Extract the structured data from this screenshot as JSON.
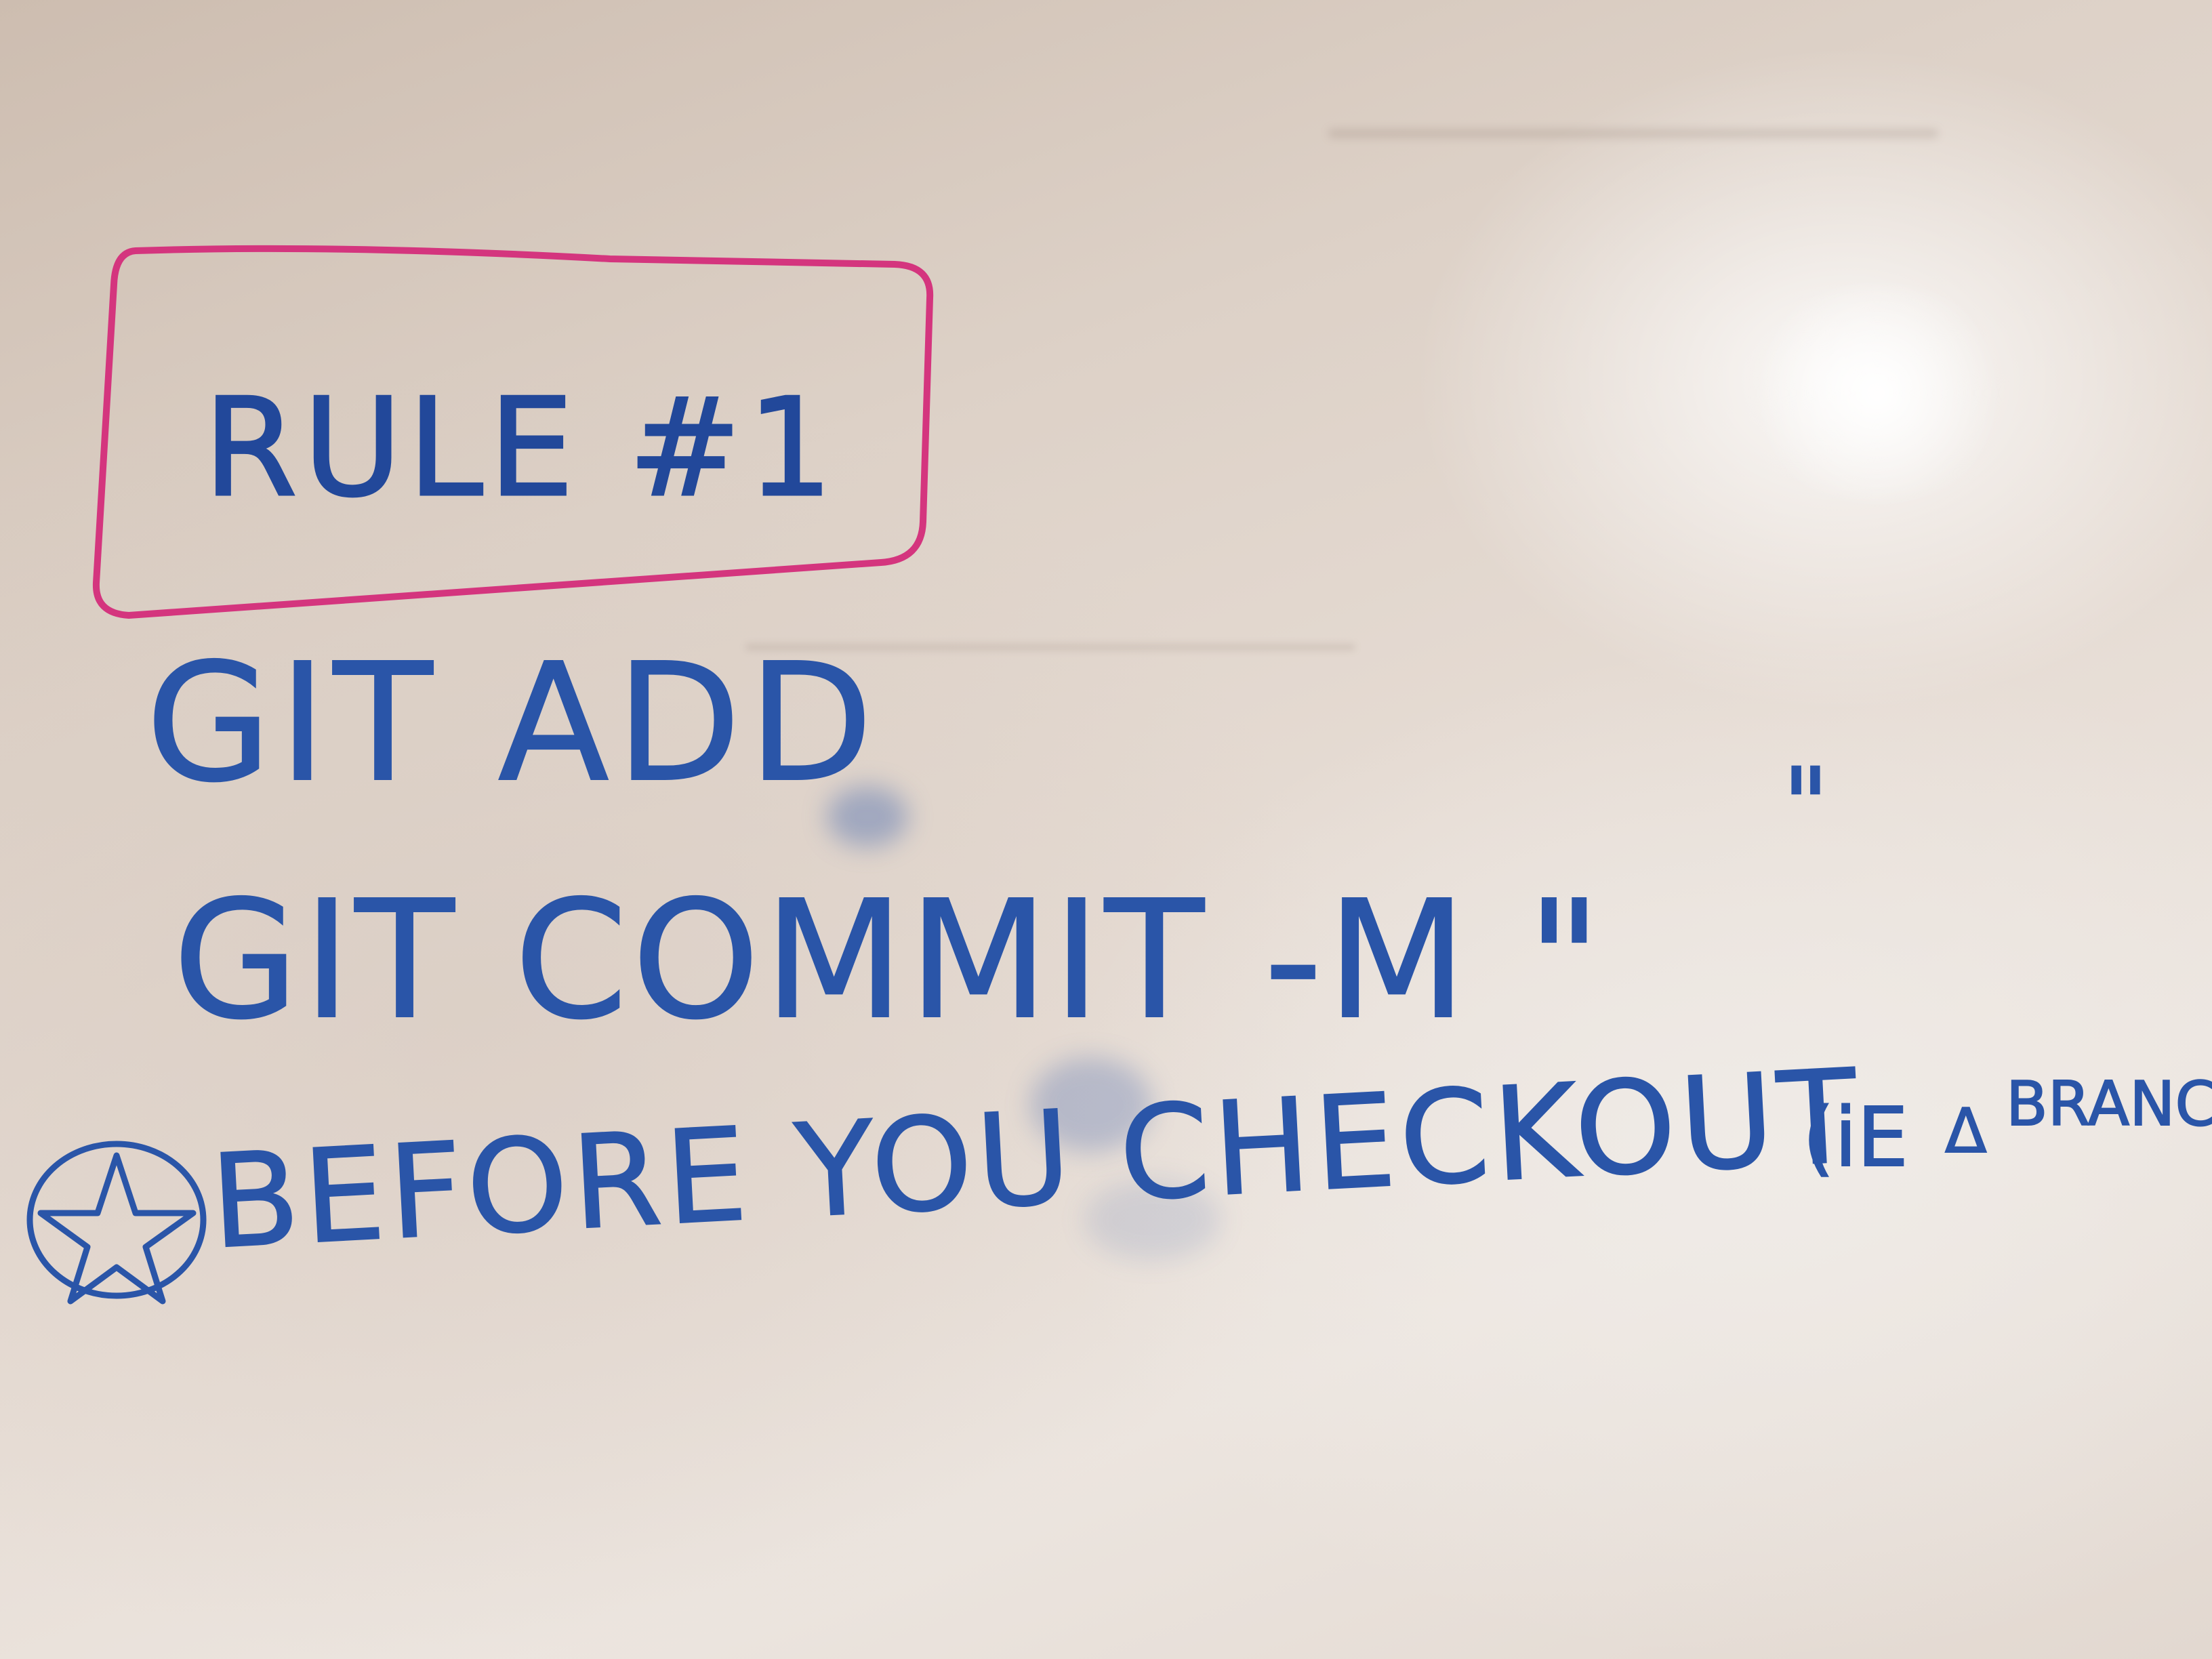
{
  "whiteboard": {
    "rule_title": "RULE #1",
    "lines": [
      "GIT ADD",
      "GIT COMMIT -M \"",
      "\""
    ],
    "note": "BEFORE YOU CHECKOUT",
    "note_tail": "(iE",
    "note_delta": "Δ",
    "note_branch": "BRANC",
    "colors": {
      "blue_marker": "#2a55a8",
      "pink_marker": "#d4357e",
      "board": "#e6dcd4"
    }
  }
}
